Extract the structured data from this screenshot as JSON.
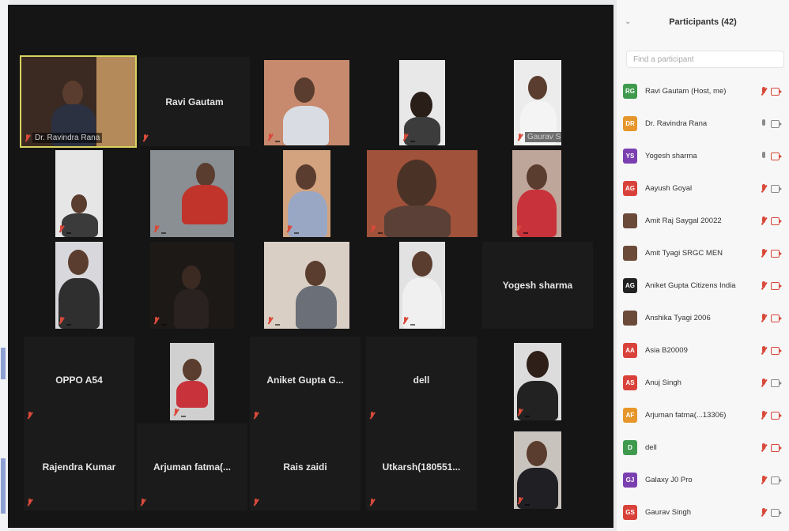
{
  "colors": {
    "video_bg": "#151515",
    "active_speaker_border": "#d8d35f",
    "muted_red": "#d84a3a",
    "sidebar_bg": "#f7f7f8"
  },
  "tiles": [
    {
      "name": "Dr. Ravindra Rana",
      "kind": "video",
      "active": true
    },
    {
      "name": "Ravi Gautam",
      "kind": "name"
    },
    {
      "name": "",
      "kind": "video"
    },
    {
      "name": "",
      "kind": "video"
    },
    {
      "name": "Gaurav Singh",
      "kind": "video"
    },
    {
      "name": "",
      "kind": "video"
    },
    {
      "name": "",
      "kind": "video"
    },
    {
      "name": "",
      "kind": "video"
    },
    {
      "name": "",
      "kind": "video"
    },
    {
      "name": "",
      "kind": "video"
    },
    {
      "name": "",
      "kind": "video"
    },
    {
      "name": "",
      "kind": "video_dark"
    },
    {
      "name": "",
      "kind": "video"
    },
    {
      "name": "",
      "kind": "video"
    },
    {
      "name": "Yogesh sharma",
      "kind": "name"
    },
    {
      "name": "OPPO A54",
      "kind": "name"
    },
    {
      "name": "",
      "kind": "video"
    },
    {
      "name": "Aniket Gupta G...",
      "kind": "name"
    },
    {
      "name": "dell",
      "kind": "name"
    },
    {
      "name": "",
      "kind": "video"
    },
    {
      "name": "Rajendra Kumar",
      "kind": "name"
    },
    {
      "name": "Arjuman fatma(...",
      "kind": "name"
    },
    {
      "name": "Rais zaidi",
      "kind": "name"
    },
    {
      "name": "Utkarsh(180551...",
      "kind": "name"
    },
    {
      "name": "",
      "kind": "video"
    }
  ],
  "sidebar": {
    "title": "Participants (42)",
    "search_placeholder": "Find a participant",
    "participants": [
      {
        "initials": "RG",
        "name": "Ravi Gautam (Host, me)",
        "color": "#3f9a4e",
        "mic": "muted",
        "cam": "off"
      },
      {
        "initials": "DR",
        "name": "Dr. Ravindra Rana",
        "color": "#e6962a",
        "mic": "on",
        "cam": "on"
      },
      {
        "initials": "YS",
        "name": "Yogesh sharma",
        "color": "#7a3fb0",
        "mic": "on",
        "cam": "off"
      },
      {
        "initials": "AG",
        "name": "Aayush Goyal",
        "color": "#d9423a",
        "mic": "muted",
        "cam": "on"
      },
      {
        "initials": "",
        "name": "Amit Raj Saygal 20022",
        "color": "#6b4a3a",
        "mic": "muted",
        "cam": "off"
      },
      {
        "initials": "",
        "name": "Amit Tyagi SRGC MEN",
        "color": "#6b4a3a",
        "mic": "muted",
        "cam": "off"
      },
      {
        "initials": "AG",
        "name": "Aniket Gupta Citizens India",
        "color": "#222222",
        "mic": "muted",
        "cam": "off"
      },
      {
        "initials": "",
        "name": "Anshika Tyagi 2006",
        "color": "#6b4a3a",
        "mic": "muted",
        "cam": "off"
      },
      {
        "initials": "AA",
        "name": "Asia B20009",
        "color": "#d9423a",
        "mic": "muted",
        "cam": "off"
      },
      {
        "initials": "AS",
        "name": "Anuj Singh",
        "color": "#d9423a",
        "mic": "muted",
        "cam": "on"
      },
      {
        "initials": "AF",
        "name": "Arjuman fatma(...13306)",
        "color": "#e6962a",
        "mic": "muted",
        "cam": "off"
      },
      {
        "initials": "D",
        "name": "dell",
        "color": "#3f9a4e",
        "mic": "muted",
        "cam": "off"
      },
      {
        "initials": "GJ",
        "name": "Galaxy J0 Pro",
        "color": "#7a3fb0",
        "mic": "muted",
        "cam": "on"
      },
      {
        "initials": "GS",
        "name": "Gaurav Singh",
        "color": "#d9423a",
        "mic": "muted",
        "cam": "on"
      }
    ]
  }
}
